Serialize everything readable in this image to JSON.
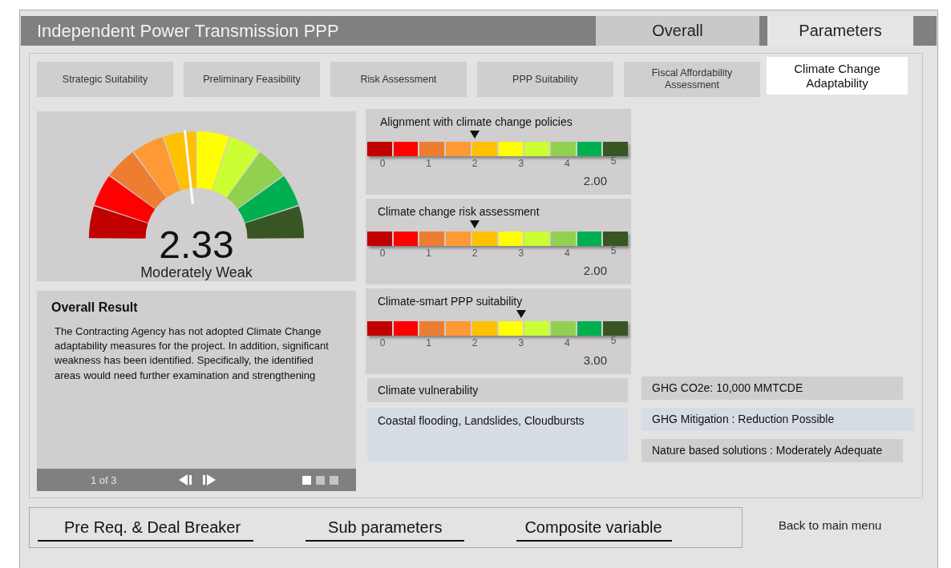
{
  "window": {
    "title": "Independent Power Transmission PPP"
  },
  "tabs": [
    {
      "label": "Overall",
      "selected": false
    },
    {
      "label": "Parameters",
      "selected": true
    }
  ],
  "sub_tabs": [
    {
      "label": "Strategic Suitability",
      "selected": false
    },
    {
      "label": "Preliminary Feasibility",
      "selected": false
    },
    {
      "label": "Risk Assessment",
      "selected": false
    },
    {
      "label": "PPP Suitability",
      "selected": false
    },
    {
      "label": "Fiscal Affordability Assessment",
      "selected": false
    },
    {
      "label": "Climate Change Adaptability",
      "selected": true
    }
  ],
  "gauge": {
    "level": 0.466,
    "score": "2.33",
    "rating": "Moderately Weak"
  },
  "overall_result": {
    "title": "Overall Result",
    "text": "The Contracting Agency has not adopted Climate Change adaptability measures for the project. In addition, significant weakness  has been identified. Specifically, the identified areas would need further examination and strengthening",
    "pager": {
      "label": "1 of 3",
      "pages": [
        {
          "selected": true
        },
        {
          "selected": false
        },
        {
          "selected": false
        }
      ]
    }
  },
  "scales": [
    {
      "title": "Alignment with climate change policies",
      "level": 0.4,
      "value": "2.00",
      "ticks": [
        "0",
        "1",
        "2",
        "3",
        "4",
        "5"
      ]
    },
    {
      "title": "Climate change risk assessment",
      "level": 0.4,
      "value": "2.00",
      "ticks": [
        "0",
        "1",
        "2",
        "3",
        "4",
        "5"
      ]
    },
    {
      "title": "Climate-smart PPP suitability",
      "level": 0.6,
      "value": "3.00",
      "ticks": [
        "0",
        "1",
        "2",
        "3",
        "4",
        "5"
      ]
    }
  ],
  "vulnerability": {
    "label": "Climate vulnerability",
    "value": "Coastal flooding, Landslides, Cloudbursts"
  },
  "facts": [
    {
      "text": "GHG CO2e: 10,000 MMTCDE",
      "kind": "plain"
    },
    {
      "text": "GHG Mitigation  : Reduction Possible",
      "kind": "highlight"
    },
    {
      "text": "Nature based solutions : Moderately Adequate",
      "kind": "plain"
    }
  ],
  "nav_links": [
    "Pre Req. & Deal Breaker",
    "Sub parameters",
    "Composite variable"
  ],
  "back_link": "Back to main menu"
}
